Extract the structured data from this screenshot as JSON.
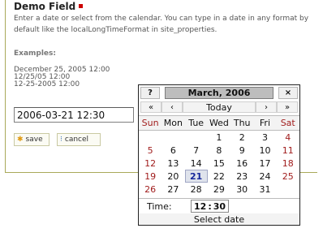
{
  "field": {
    "title": "Demo Field",
    "help_text": "Enter a date or select from the calendar. You can type in a date in any format by default like the localLongTimeFormat in site_properties.",
    "examples_label": "Examples:",
    "examples": [
      "December 25, 2005 12:00",
      "12/25/05 12:00",
      "12-25-2005 12:00"
    ],
    "input_value": "2006-03-21 12:30"
  },
  "buttons": {
    "save_label": "save",
    "cancel_label": "cancel"
  },
  "calendar": {
    "help_label": "?",
    "title": "March, 2006",
    "close_label": "×",
    "nav": {
      "prev_year": "«",
      "prev_month": "‹",
      "today": "Today",
      "next_month": "›",
      "next_year": "»"
    },
    "weekdays": [
      "Sun",
      "Mon",
      "Tue",
      "Wed",
      "Thu",
      "Fri",
      "Sat"
    ],
    "weeks": [
      [
        "",
        "",
        "",
        "1",
        "2",
        "3",
        "4"
      ],
      [
        "5",
        "6",
        "7",
        "8",
        "9",
        "10",
        "11"
      ],
      [
        "12",
        "13",
        "14",
        "15",
        "16",
        "17",
        "18"
      ],
      [
        "19",
        "20",
        "21",
        "22",
        "23",
        "24",
        "25"
      ],
      [
        "26",
        "27",
        "28",
        "29",
        "30",
        "31",
        ""
      ]
    ],
    "selected_day": "21",
    "time_label": "Time:",
    "hour": "12",
    "minute": "30",
    "status_text": "Select date"
  },
  "colors": {
    "weekend": "#a11d1d",
    "today_text": "#15279b",
    "required": "#cc0000",
    "border": "#a9a95a"
  },
  "icons": {
    "save": "star-icon",
    "cancel": "dots-icon"
  }
}
